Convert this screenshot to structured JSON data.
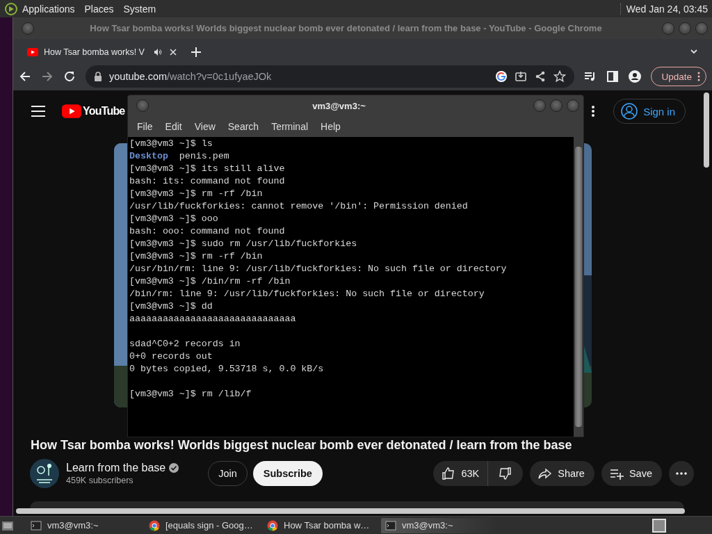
{
  "top_panel": {
    "menus": [
      "Applications",
      "Places",
      "System"
    ],
    "clock": "Wed Jan 24, 03:45"
  },
  "browser": {
    "window_title": "How Tsar bomba works! Worlds biggest nuclear bomb ever detonated / learn from the base - YouTube - Google Chrome",
    "tabs": [
      {
        "title": "How Tsar bomba works! V",
        "selected": true,
        "audio": true
      }
    ],
    "url_host": "youtube.com",
    "url_path": "/watch?v=0c1ufyaeJOk",
    "update_label": "Update"
  },
  "youtube": {
    "logo": "YouTube",
    "sign_in": "Sign in",
    "title": "How Tsar bomba works! Worlds biggest nuclear bomb ever detonated / learn from the base",
    "channel": {
      "name": "Learn from the base",
      "verified": true,
      "subscribers": "459K subscribers"
    },
    "join": "Join",
    "subscribe": "Subscribe",
    "likes": "63K",
    "share": "Share",
    "save": "Save"
  },
  "terminal": {
    "title": "vm3@vm3:~",
    "menus": [
      "File",
      "Edit",
      "View",
      "Search",
      "Terminal",
      "Help"
    ],
    "lines": [
      {
        "kind": "prompt",
        "prompt": "[vm3@vm3 ~]$",
        "command": "ls"
      },
      {
        "kind": "listing",
        "entries": [
          {
            "name": "Desktop",
            "kind": "directory"
          },
          {
            "name": "penis.pem",
            "kind": "file"
          }
        ]
      },
      {
        "kind": "prompt",
        "prompt": "[vm3@vm3 ~]$",
        "command": "its still alive"
      },
      {
        "kind": "output",
        "text": "bash: its: command not found"
      },
      {
        "kind": "prompt",
        "prompt": "[vm3@vm3 ~]$",
        "command": "rm -rf /bin"
      },
      {
        "kind": "output",
        "text": "/usr/lib/fuckforkies: cannot remove '/bin': Permission denied"
      },
      {
        "kind": "prompt",
        "prompt": "[vm3@vm3 ~]$",
        "command": "ooo"
      },
      {
        "kind": "output",
        "text": "bash: ooo: command not found"
      },
      {
        "kind": "prompt",
        "prompt": "[vm3@vm3 ~]$",
        "command": "sudo rm /usr/lib/fuckforkies"
      },
      {
        "kind": "prompt",
        "prompt": "[vm3@vm3 ~]$",
        "command": "rm -rf /bin"
      },
      {
        "kind": "output",
        "text": "/usr/bin/rm: line 9: /usr/lib/fuckforkies: No such file or directory"
      },
      {
        "kind": "prompt",
        "prompt": "[vm3@vm3 ~]$",
        "command": "/bin/rm -rf /bin"
      },
      {
        "kind": "output",
        "text": "/bin/rm: line 9: /usr/lib/fuckforkies: No such file or directory"
      },
      {
        "kind": "prompt",
        "prompt": "[vm3@vm3 ~]$",
        "command": "dd"
      },
      {
        "kind": "output",
        "text": "aaaaaaaaaaaaaaaaaaaaaaaaaaaaaa"
      },
      {
        "kind": "blank"
      },
      {
        "kind": "output",
        "text": "sdad^C0+2 records in"
      },
      {
        "kind": "output",
        "text": "0+0 records out"
      },
      {
        "kind": "output",
        "text": "0 bytes copied, 9.53718 s, 0.0 kB/s"
      },
      {
        "kind": "blank"
      },
      {
        "kind": "prompt",
        "prompt": "[vm3@vm3 ~]$",
        "command": "rm /lib/f"
      }
    ]
  },
  "taskbar": {
    "items": [
      {
        "label": "vm3@vm3:~",
        "kind": "terminal",
        "selected": false
      },
      {
        "label": "[equals sign - Goog…",
        "kind": "browser",
        "selected": false
      },
      {
        "label": "How Tsar bomba w…",
        "kind": "browser",
        "selected": false
      },
      {
        "label": "vm3@vm3:~",
        "kind": "terminal",
        "selected": true
      }
    ]
  }
}
